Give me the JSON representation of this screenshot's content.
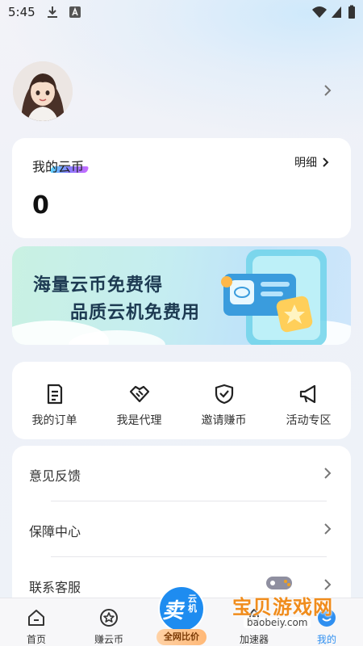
{
  "status_bar": {
    "time": "5:45"
  },
  "coins": {
    "title": "我的云币",
    "detail_label": "明细",
    "value": "0"
  },
  "banner": {
    "line1": "海量云币免费得",
    "line2": "品质云机免费用"
  },
  "menu": [
    {
      "label": "我的订单",
      "icon": "order-icon"
    },
    {
      "label": "我是代理",
      "icon": "handshake-icon"
    },
    {
      "label": "邀请赚币",
      "icon": "shield-check-icon"
    },
    {
      "label": "活动专区",
      "icon": "megaphone-icon"
    }
  ],
  "list": [
    {
      "label": "意见反馈"
    },
    {
      "label": "保障中心"
    },
    {
      "label": "联系客服"
    }
  ],
  "nav": {
    "home": "首页",
    "earn": "赚云币",
    "sell_main": "卖",
    "sell_sub": "云机",
    "sell_pill": "全网比价",
    "speed": "加速器",
    "mine": "我的"
  },
  "watermark": {
    "text": "宝贝游戏网",
    "url": "baobeiy.com"
  },
  "colors": {
    "accent_blue": "#2f8ff0",
    "text": "#222222",
    "card_bg": "#ffffff"
  }
}
